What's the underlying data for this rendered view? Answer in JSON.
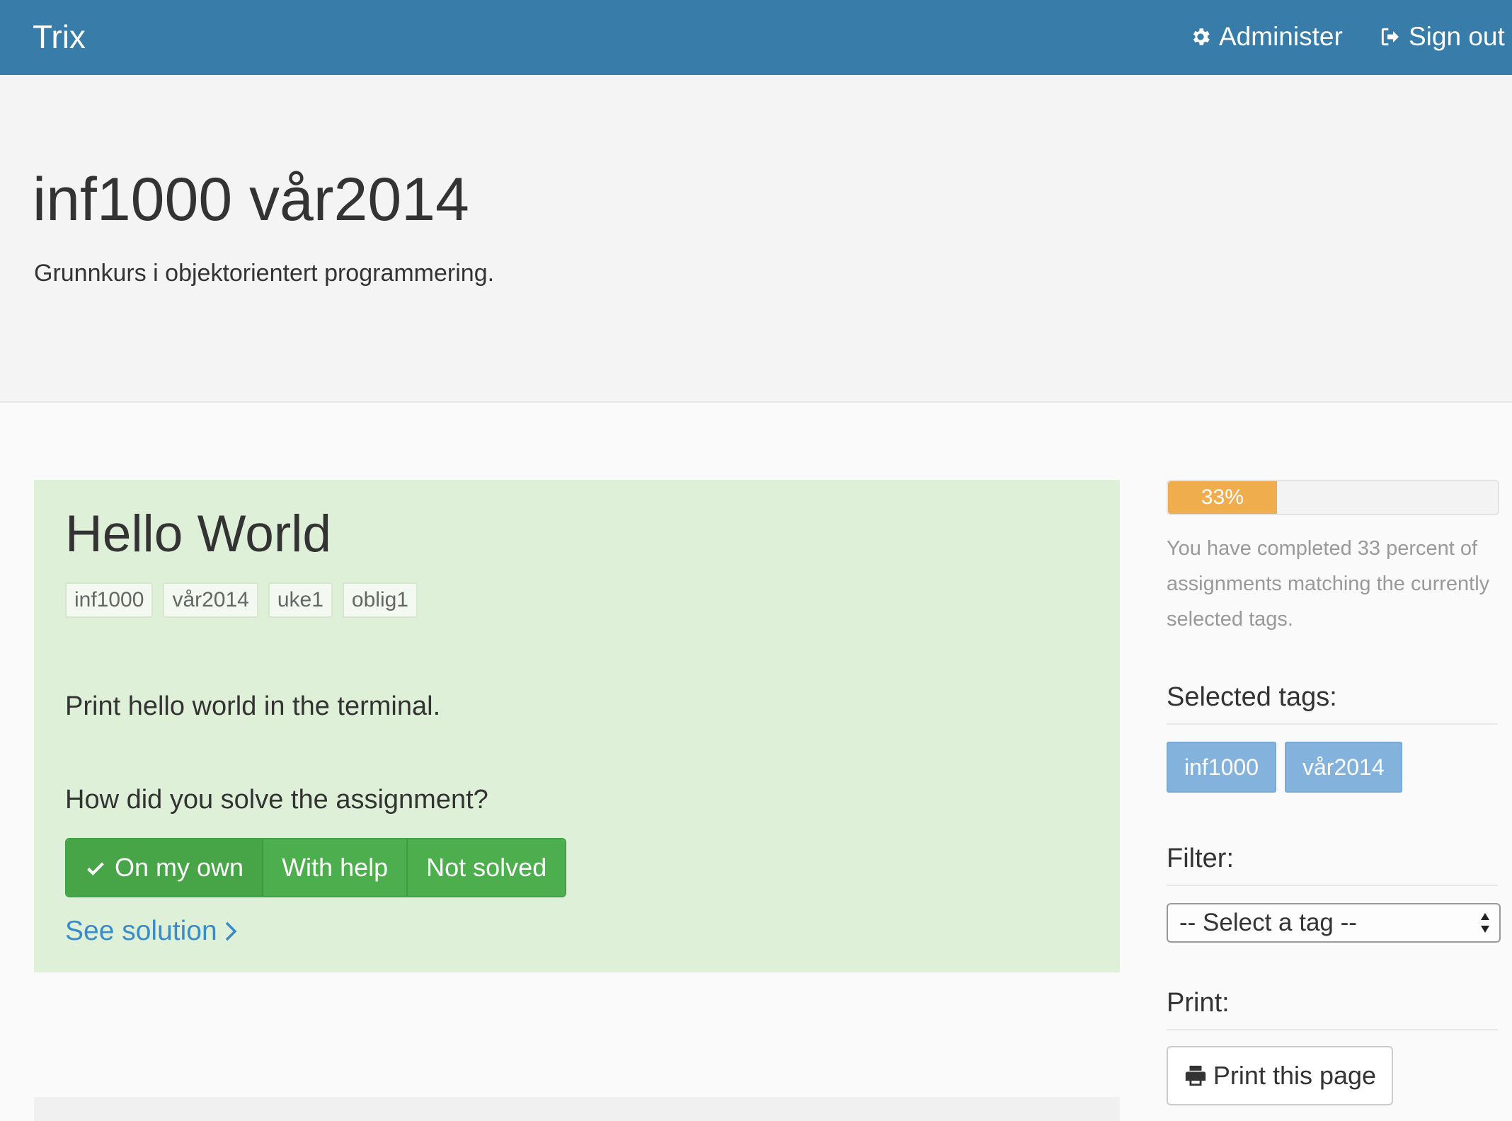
{
  "navbar": {
    "brand": "Trix",
    "administer_label": "Administer",
    "signout_label": "Sign out",
    "color": "#387ca9"
  },
  "course": {
    "title": "inf1000 vår2014",
    "description": "Grunnkurs i objektorientert programmering."
  },
  "assignment": {
    "title": "Hello World",
    "tags": [
      "inf1000",
      "vår2014",
      "uke1",
      "oblig1"
    ],
    "body": "Print hello world in the terminal.",
    "question": "How did you solve the assignment?",
    "options": [
      {
        "label": "On my own",
        "selected": true,
        "icon": "check-icon"
      },
      {
        "label": "With help",
        "selected": false
      },
      {
        "label": "Not solved",
        "selected": false
      }
    ],
    "solution_link": "See solution",
    "background": "#dff0d8",
    "button_color": "#4cae4c"
  },
  "sidebar": {
    "progress": {
      "percent": 33,
      "label": "33%",
      "color": "#f0ad4e",
      "help_text": "You have completed 33 percent of assignments matching the currently selected tags."
    },
    "selected_tags_heading": "Selected tags:",
    "selected_tags": [
      "inf1000",
      "vår2014"
    ],
    "filter_heading": "Filter:",
    "filter_select_value": "-- Select a tag --",
    "print_heading": "Print:",
    "print_button_label": "Print this page"
  }
}
